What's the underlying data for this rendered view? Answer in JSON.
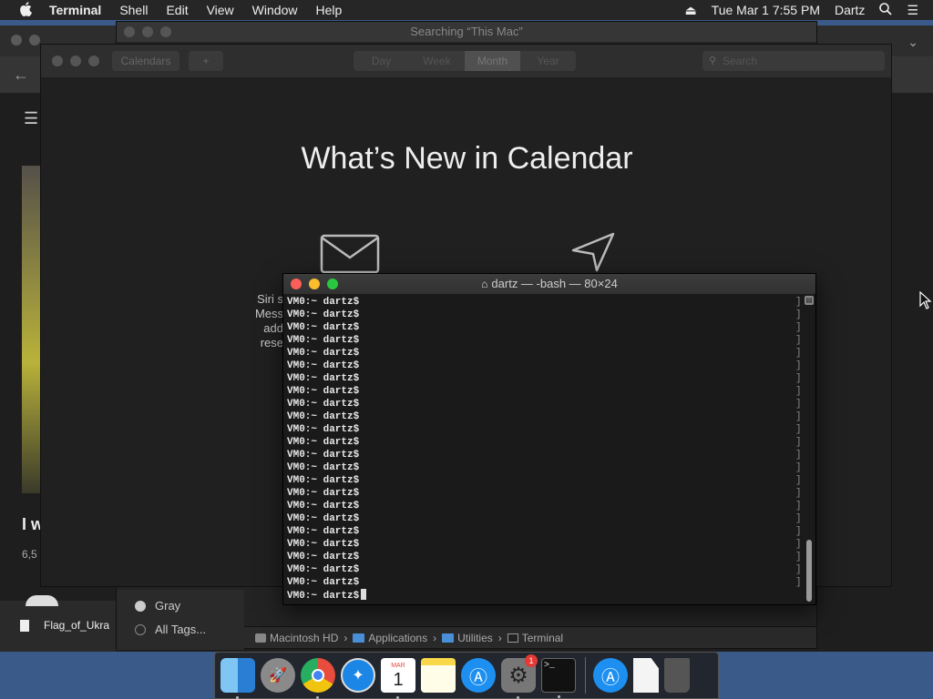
{
  "menubar": {
    "app_name": "Terminal",
    "items": [
      "Shell",
      "Edit",
      "View",
      "Window",
      "Help"
    ],
    "clock": "Tue Mar 1  7:55 PM",
    "user": "Dartz"
  },
  "browser": {
    "headline": "I w",
    "count": "6,5",
    "download_file": "Flag_of_Ukra"
  },
  "finder": {
    "title": "Searching “This Mac”",
    "tags": [
      "Gray",
      "All Tags..."
    ],
    "path": [
      "Macintosh HD",
      "Applications",
      "Utilities",
      "Terminal"
    ]
  },
  "calendar": {
    "calendars_button": "Calendars",
    "add_button": "+",
    "views": [
      "Day",
      "Week",
      "Month",
      "Year"
    ],
    "active_view": "Month",
    "search_placeholder": "Search",
    "headline": "What’s New in Calendar",
    "siri_lines": [
      "Siri s",
      "Mess",
      "add",
      "rese"
    ]
  },
  "terminal": {
    "title": "dartz — -bash — 80×24",
    "prompt": "VM0:~ dartz$",
    "lines": 24
  },
  "dock": {
    "calendar_month": "MAR",
    "calendar_day": "1",
    "prefs_badge": "1",
    "terminal_glyph": ">_"
  }
}
